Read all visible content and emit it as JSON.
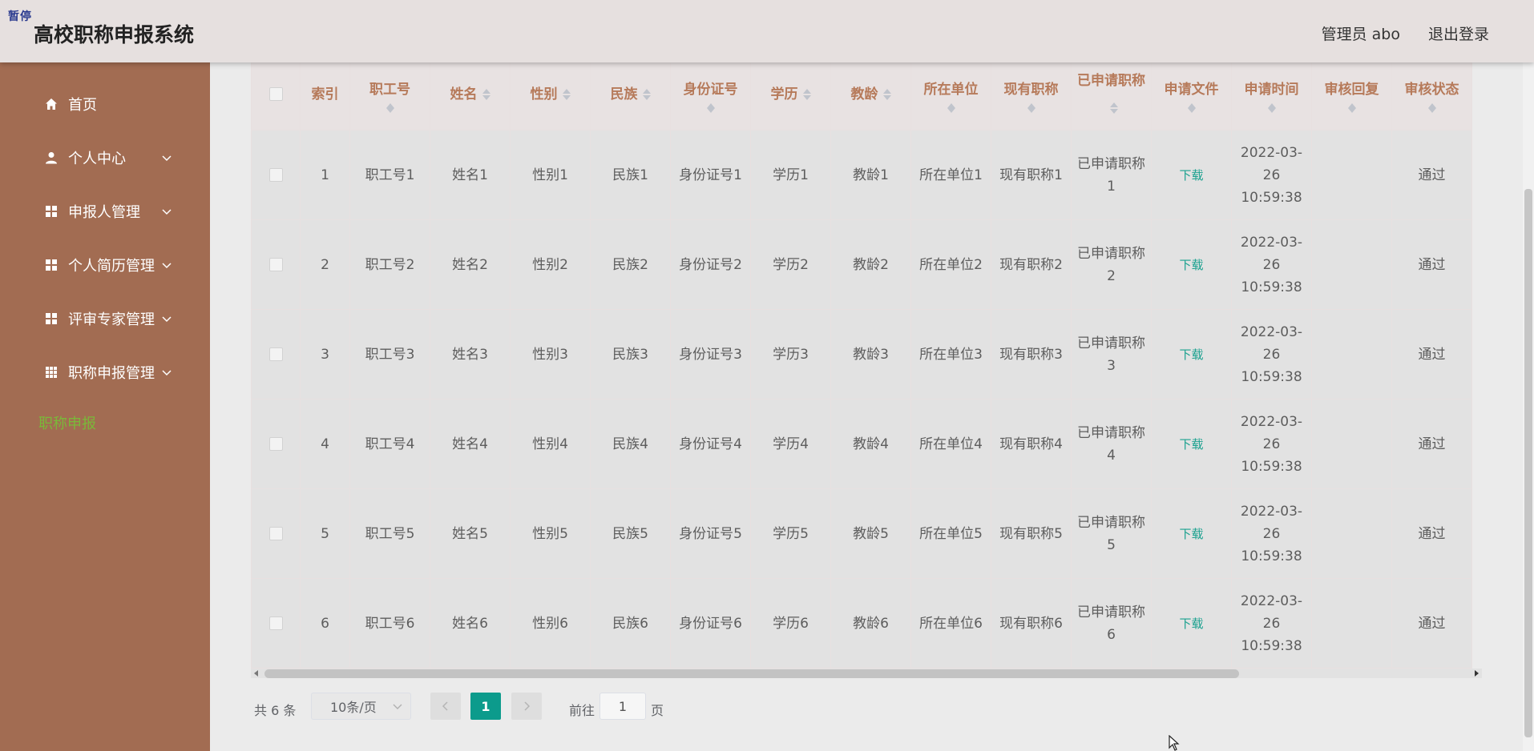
{
  "header": {
    "badge": "暂停",
    "title": "高校职称申报系统",
    "user": "管理员 abo",
    "logout": "退出登录"
  },
  "sidebar": {
    "items": [
      {
        "label": "首页",
        "icon": "home-icon",
        "has_chevron": false
      },
      {
        "label": "个人中心",
        "icon": "user-icon",
        "has_chevron": true
      },
      {
        "label": "申报人管理",
        "icon": "grid-icon",
        "has_chevron": true
      },
      {
        "label": "个人简历管理",
        "icon": "grid-icon",
        "has_chevron": true
      },
      {
        "label": "评审专家管理",
        "icon": "grid-icon",
        "has_chevron": true
      },
      {
        "label": "职称申报管理",
        "icon": "apps-icon",
        "has_chevron": true
      }
    ],
    "sub_item": "职称申报",
    "sub_item_color": "#7ab839",
    "bg_color": "#a26c52"
  },
  "table": {
    "header_color": "#b67a5a",
    "columns": [
      "索引",
      "职工号",
      "姓名",
      "性别",
      "民族",
      "身份证号",
      "学历",
      "教龄",
      "所在单位",
      "现有职称",
      "已申请职称",
      "申请文件",
      "申请时间",
      "审核回复",
      "审核状态"
    ],
    "rows": [
      {
        "cells": [
          "1",
          "职工号1",
          "姓名1",
          "性别1",
          "民族1",
          "身份证号1",
          "学历1",
          "教龄1",
          "所在单位1",
          "现有职称1",
          "已申请职称1",
          "下载",
          "2022-03-26 10:59:38",
          "",
          "通过"
        ]
      },
      {
        "cells": [
          "2",
          "职工号2",
          "姓名2",
          "性别2",
          "民族2",
          "身份证号2",
          "学历2",
          "教龄2",
          "所在单位2",
          "现有职称2",
          "已申请职称2",
          "下载",
          "2022-03-26 10:59:38",
          "",
          "通过"
        ]
      },
      {
        "cells": [
          "3",
          "职工号3",
          "姓名3",
          "性别3",
          "民族3",
          "身份证号3",
          "学历3",
          "教龄3",
          "所在单位3",
          "现有职称3",
          "已申请职称3",
          "下载",
          "2022-03-26 10:59:38",
          "",
          "通过"
        ]
      },
      {
        "cells": [
          "4",
          "职工号4",
          "姓名4",
          "性别4",
          "民族4",
          "身份证号4",
          "学历4",
          "教龄4",
          "所在单位4",
          "现有职称4",
          "已申请职称4",
          "下载",
          "2022-03-26 10:59:38",
          "",
          "通过"
        ]
      },
      {
        "cells": [
          "5",
          "职工号5",
          "姓名5",
          "性别5",
          "民族5",
          "身份证号5",
          "学历5",
          "教龄5",
          "所在单位5",
          "现有职称5",
          "已申请职称5",
          "下载",
          "2022-03-26 10:59:38",
          "",
          "通过"
        ]
      },
      {
        "cells": [
          "6",
          "职工号6",
          "姓名6",
          "性别6",
          "民族6",
          "身份证号6",
          "学历6",
          "教龄6",
          "所在单位6",
          "现有职称6",
          "已申请职称6",
          "下载",
          "2022-03-26 10:59:38",
          "",
          "通过"
        ]
      }
    ]
  },
  "pagination": {
    "total": "共 6 条",
    "page_size": "10条/页",
    "current_page": "1",
    "goto_label": "前往",
    "goto_value": "1",
    "page_unit": "页",
    "active_color": "#0c9b8c"
  }
}
